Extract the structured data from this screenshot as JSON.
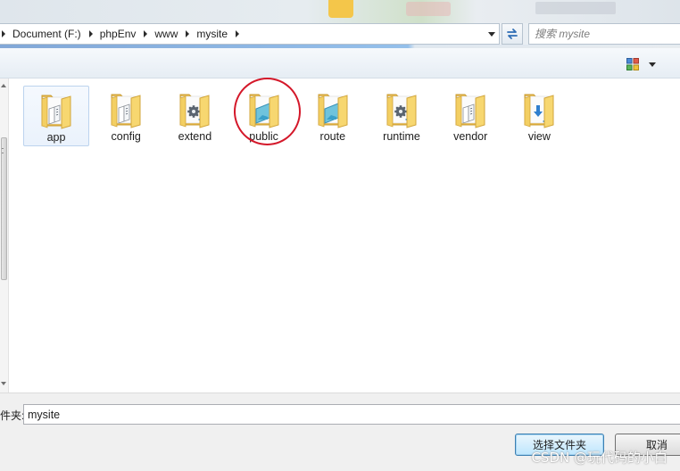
{
  "breadcrumb": {
    "segments": [
      "Document (F:)",
      "phpEnv",
      "www",
      "mysite"
    ]
  },
  "search": {
    "placeholder": "搜索 mysite"
  },
  "folders": [
    {
      "name": "app",
      "overlay": "none",
      "selected": true
    },
    {
      "name": "config",
      "overlay": "none",
      "selected": false
    },
    {
      "name": "extend",
      "overlay": "gear",
      "selected": false
    },
    {
      "name": "public",
      "overlay": "image",
      "selected": false
    },
    {
      "name": "route",
      "overlay": "image",
      "selected": false
    },
    {
      "name": "runtime",
      "overlay": "gear",
      "selected": false
    },
    {
      "name": "vendor",
      "overlay": "none",
      "selected": false
    },
    {
      "name": "view",
      "overlay": "arrow",
      "selected": false
    }
  ],
  "footer": {
    "folder_label": "件夹:",
    "folder_value": "mysite",
    "select_button": "选择文件夹",
    "cancel_button": "取消",
    "watermark": "CSDN @玩代码的小白"
  },
  "colors": {
    "annotation_circle": "#d4182a",
    "folder_yellow": "#f5d168",
    "primary_button_border": "#3c7fb1"
  }
}
